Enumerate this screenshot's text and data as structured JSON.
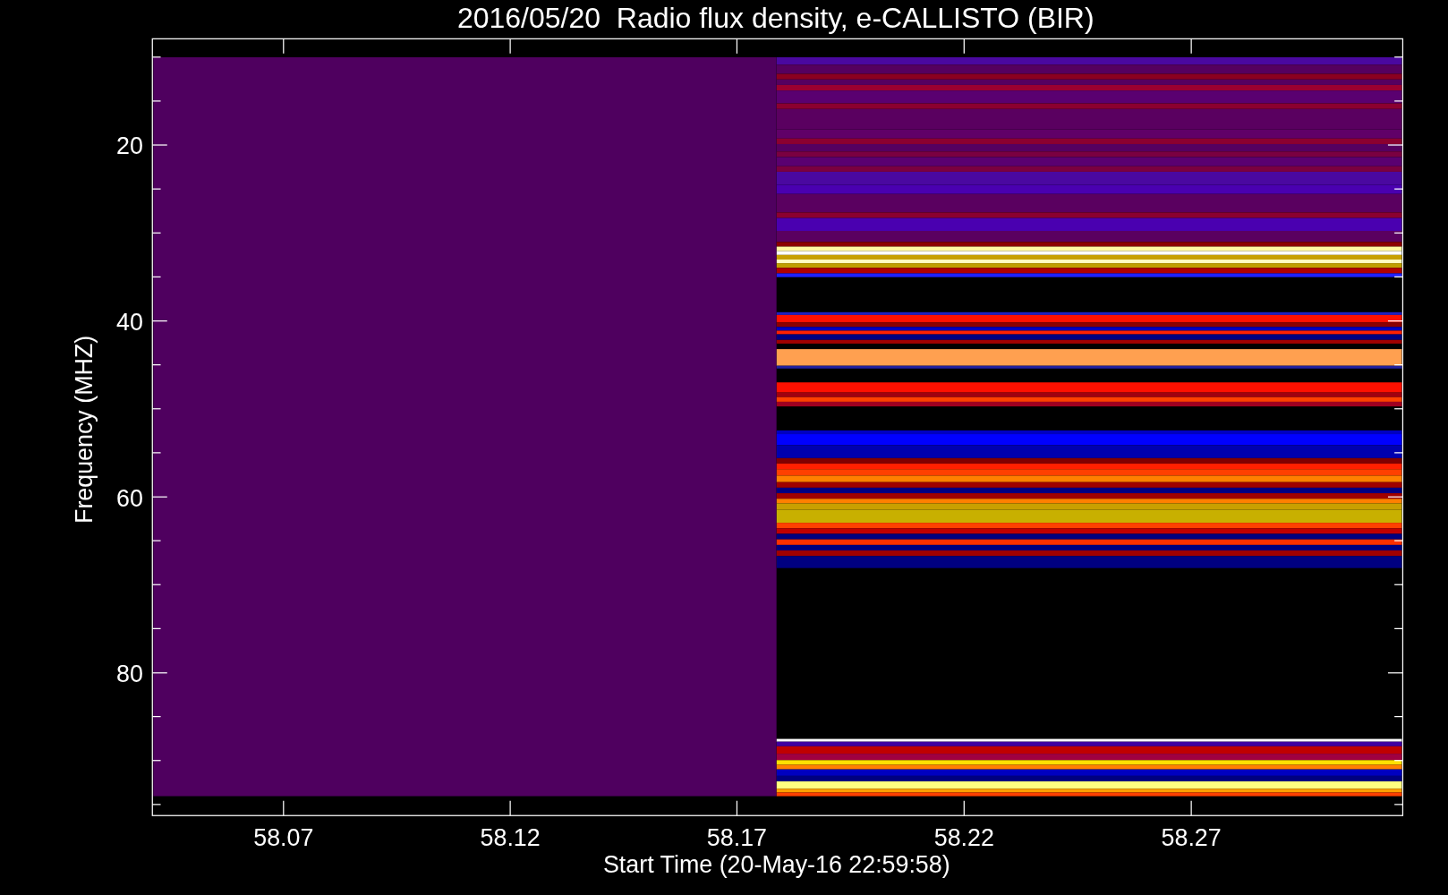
{
  "title": "2016/05/20  Radio flux density, e-CALLISTO (BIR)",
  "y_axis": {
    "label": "Frequency (MHZ)",
    "tick_labels": [
      "20",
      "40",
      "60",
      "80"
    ]
  },
  "x_axis": {
    "label": "Start Time (20-May-16 22:59:58)",
    "tick_labels": [
      "58.07",
      "58.12",
      "58.17",
      "58.22",
      "58.27"
    ]
  }
}
